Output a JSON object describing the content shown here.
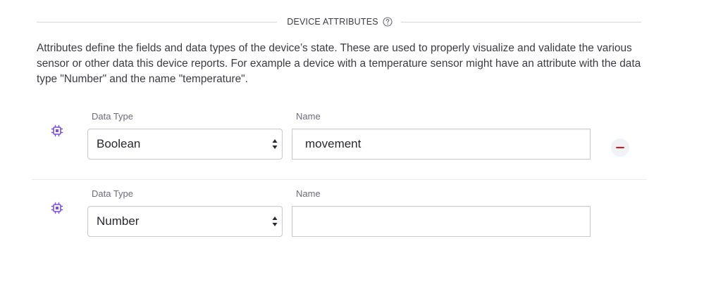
{
  "section": {
    "title": "DEVICE ATTRIBUTES",
    "description": "Attributes define the fields and data types of the device’s state. These are used to properly visualize and validate the various sensor or other data this device reports. For example a device with a temperature sensor might have an attribute with the data type \"Number\" and the name \"temperature\"."
  },
  "attributes": [
    {
      "data_type_label": "Data Type",
      "data_type_value": "Boolean",
      "name_label": "Name",
      "name_value": "movement",
      "removable": true
    },
    {
      "data_type_label": "Data Type",
      "data_type_value": "Number",
      "name_label": "Name",
      "name_value": "",
      "removable": false
    }
  ],
  "colors": {
    "accent_icon": "#7b4fe0",
    "remove": "#da1414"
  },
  "icons": {
    "help": "question-circle-icon",
    "attribute": "chip-icon",
    "remove": "minus-icon"
  }
}
